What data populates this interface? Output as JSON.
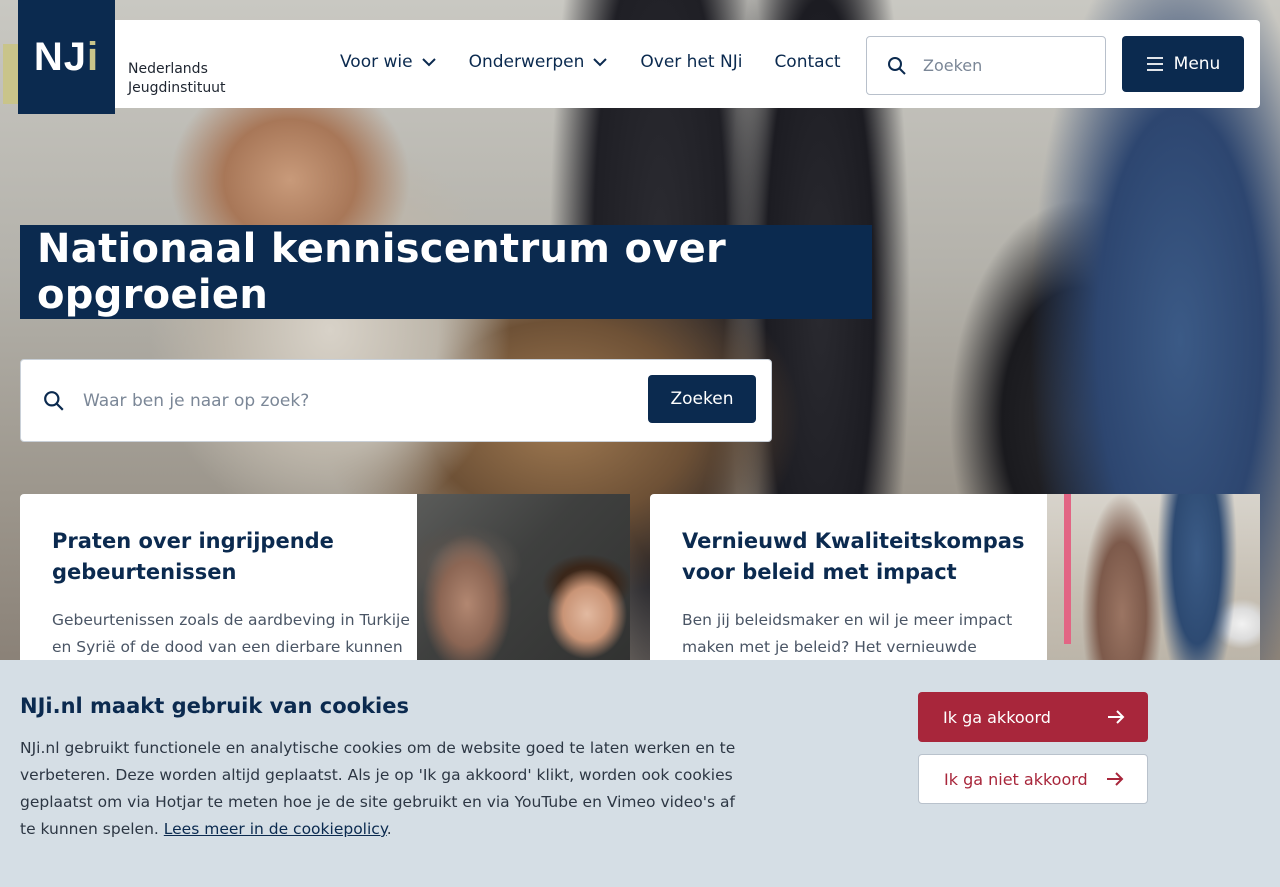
{
  "brand": {
    "logo_text_main": "NJ",
    "logo_text_accent": "i",
    "name_line1": "Nederlands",
    "name_line2": "Jeugdinstituut"
  },
  "nav": {
    "items": [
      {
        "label": "Voor wie",
        "has_dropdown": true
      },
      {
        "label": "Onderwerpen",
        "has_dropdown": true
      },
      {
        "label": "Over het NJi",
        "has_dropdown": false
      },
      {
        "label": "Contact",
        "has_dropdown": false
      }
    ],
    "search_placeholder": "Zoeken",
    "menu_label": "Menu"
  },
  "hero": {
    "title": "Nationaal kenniscentrum over opgroeien",
    "search_placeholder": "Waar ben je naar op zoek?",
    "search_button": "Zoeken"
  },
  "cards": [
    {
      "title": "Praten over ingrijpende gebeurtenissen",
      "excerpt": "Gebeurtenissen zoals de aardbeving in Turkije en Syrië of de dood van een dierbare kunnen"
    },
    {
      "title": "Vernieuwd Kwaliteitskompas voor beleid met impact",
      "excerpt": "Ben jij beleidsmaker en wil je meer impact maken met je beleid? Het vernieuwde"
    }
  ],
  "cookie": {
    "title": "NJi.nl maakt gebruik van cookies",
    "body": "NJi.nl gebruikt functionele en analytische cookies om de website goed te laten werken en te verbeteren. Deze worden altijd geplaatst. Als je op 'Ik ga akkoord' klikt, worden ook cookies geplaatst om via Hotjar te meten hoe je de site gebruikt en via YouTube en Vimeo video's af te kunnen spelen.",
    "link_label": "Lees meer in de cookiepolicy",
    "link_suffix": ".",
    "accept_label": "Ik ga akkoord",
    "decline_label": "Ik ga niet akkoord"
  },
  "colors": {
    "primary": "#0b2a4f",
    "accent_gold": "#c9c48a",
    "cookie_bg": "#d5dee5",
    "accept_red": "#a8263b"
  },
  "icons": [
    "search-icon",
    "chevron-down-icon",
    "hamburger-icon",
    "arrow-right-icon"
  ]
}
